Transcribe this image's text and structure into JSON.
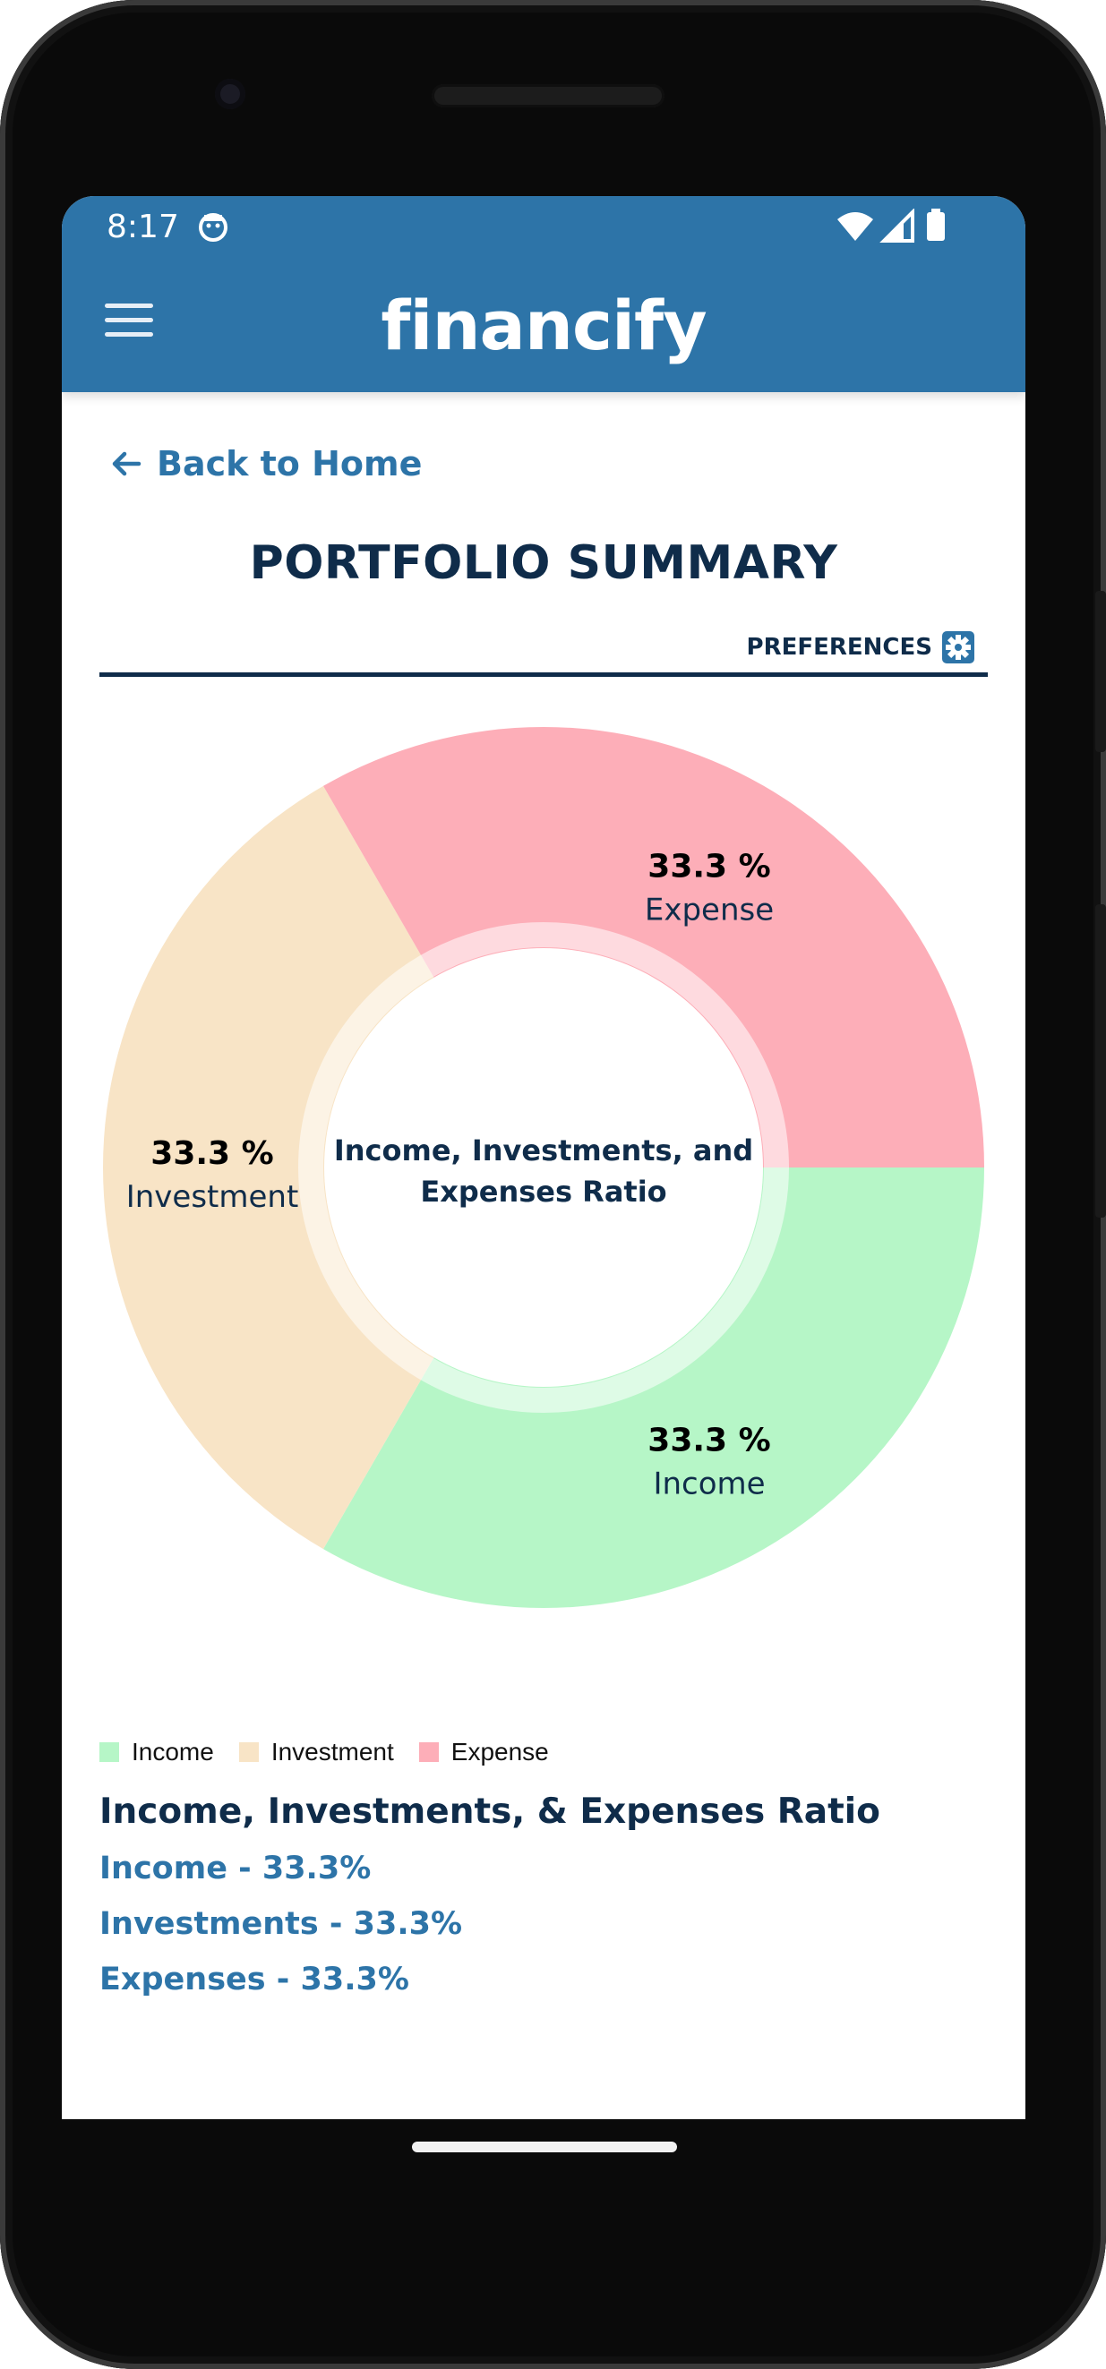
{
  "status_bar": {
    "time": "8:17"
  },
  "app": {
    "brand": "financify"
  },
  "nav": {
    "back_label": "Back to Home"
  },
  "page": {
    "title": "PORTFOLIO SUMMARY",
    "preferences_label": "PREFERENCES"
  },
  "colors": {
    "appbar": "#2d74a8",
    "income": "#b6f6c7",
    "investment": "#f8e4c6",
    "expense": "#fdaeb8",
    "title": "#0f2c4a"
  },
  "chart_data": {
    "type": "pie",
    "center_label": [
      "Income, Investments, and",
      "Expenses Ratio"
    ],
    "categories": [
      "Income",
      "Investment",
      "Expense"
    ],
    "values": [
      33.3,
      33.3,
      33.3
    ],
    "slice_labels": [
      "33.3 %",
      "33.3 %",
      "33.3 %"
    ],
    "legend": [
      "Income",
      "Investment",
      "Expense"
    ],
    "legend_placement": "bottom-left"
  },
  "summary": {
    "title": "Income, Investments, & Expenses Ratio",
    "lines": [
      "Income - 33.3%",
      "Investments - 33.3%",
      "Expenses - 33.3%"
    ]
  }
}
